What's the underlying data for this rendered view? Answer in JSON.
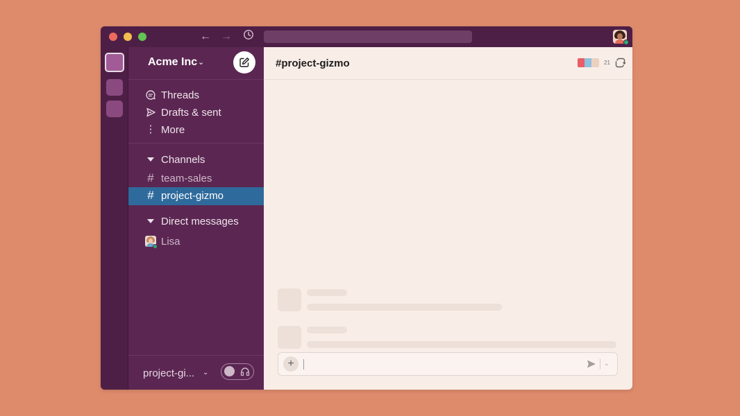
{
  "app": {
    "theme_colors": {
      "background": "#DE8B6C",
      "sidebar": "#5B2752",
      "active_channel": "#2F6A9C",
      "main": "#F9EDE7"
    }
  },
  "titlebar": {
    "back_icon": "arrow-left-icon",
    "forward_icon": "arrow-right-icon",
    "history_icon": "clock-icon"
  },
  "sidebar": {
    "workspace_name": "Acme Inc",
    "nav": [
      {
        "label": "Threads",
        "icon": "threads-icon"
      },
      {
        "label": "Drafts & sent",
        "icon": "send-icon"
      },
      {
        "label": "More",
        "icon": "more-vertical-icon"
      }
    ],
    "channels_section": "Channels",
    "channels": [
      {
        "label": "team-sales",
        "active": false
      },
      {
        "label": "project-gizmo",
        "active": true
      }
    ],
    "dm_section": "Direct messages",
    "dms": [
      {
        "label": "Lisa",
        "online": true
      }
    ],
    "footer": {
      "channel": "project-gi..."
    }
  },
  "main": {
    "channel_title": "project-gizmo",
    "channel_prefix": "#",
    "member_count": "21"
  }
}
